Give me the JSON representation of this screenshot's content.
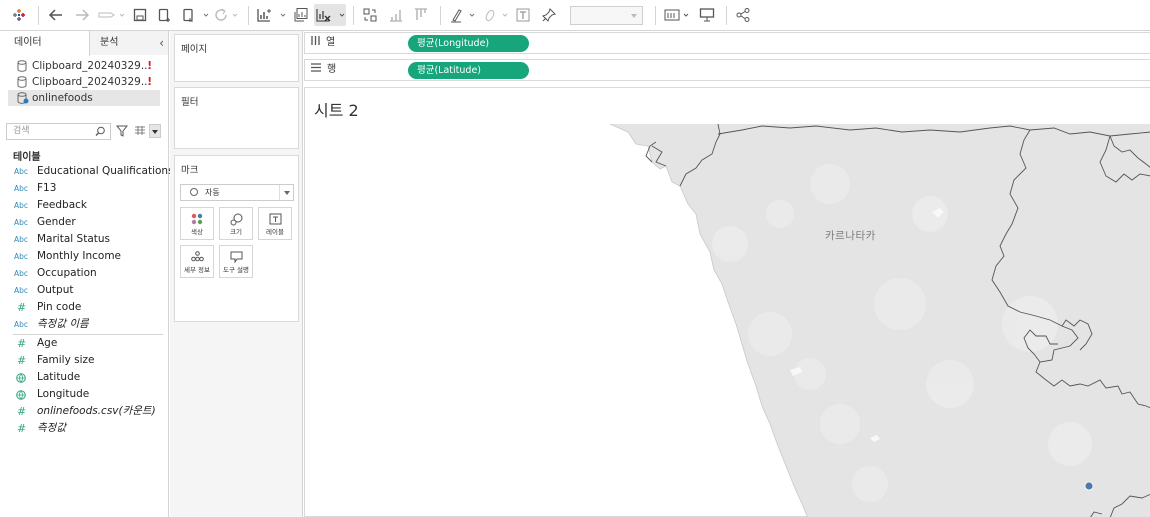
{
  "datapane": {
    "tab_data": "데이터",
    "tab_analysis": "분석",
    "datasources": [
      {
        "name": "Clipboard_20240329...",
        "warning": "!"
      },
      {
        "name": "Clipboard_20240329...",
        "warning": "!"
      },
      {
        "name": "onlinefoods",
        "warning": ""
      }
    ],
    "search_placeholder": "검색",
    "section_title": "테이블",
    "dimensions": [
      {
        "type": "Abc",
        "name": "Educational Qualifications"
      },
      {
        "type": "Abc",
        "name": "F13"
      },
      {
        "type": "Abc",
        "name": "Feedback"
      },
      {
        "type": "Abc",
        "name": "Gender"
      },
      {
        "type": "Abc",
        "name": "Marital Status"
      },
      {
        "type": "Abc",
        "name": "Monthly Income"
      },
      {
        "type": "Abc",
        "name": "Occupation"
      },
      {
        "type": "Abc",
        "name": "Output"
      },
      {
        "type": "#",
        "name": "Pin code"
      },
      {
        "type": "Abc",
        "name": "측정값 이름"
      }
    ],
    "measures": [
      {
        "type": "#",
        "name": "Age"
      },
      {
        "type": "#",
        "name": "Family size"
      },
      {
        "type": "globe",
        "name": "Latitude"
      },
      {
        "type": "globe",
        "name": "Longitude"
      },
      {
        "type": "#",
        "name": "onlinefoods.csv(카운트)"
      },
      {
        "type": "#",
        "name": "측정값"
      }
    ]
  },
  "cards": {
    "pages_title": "페이지",
    "filters_title": "필터",
    "marks_title": "마크",
    "mark_type": "자동",
    "buttons": {
      "color": "색상",
      "size": "크기",
      "label": "레이블",
      "detail": "세부 정보",
      "tooltip": "도구 설명"
    }
  },
  "shelves": {
    "columns_label": "열",
    "rows_label": "행",
    "columns_pill": "평균(Longitude)",
    "rows_pill": "평균(Latitude)"
  },
  "view": {
    "sheet_title": "시트 2",
    "map_region_label": "카르나타카",
    "mark_color": "#4e79a7",
    "pill_color": "#17a67c"
  }
}
